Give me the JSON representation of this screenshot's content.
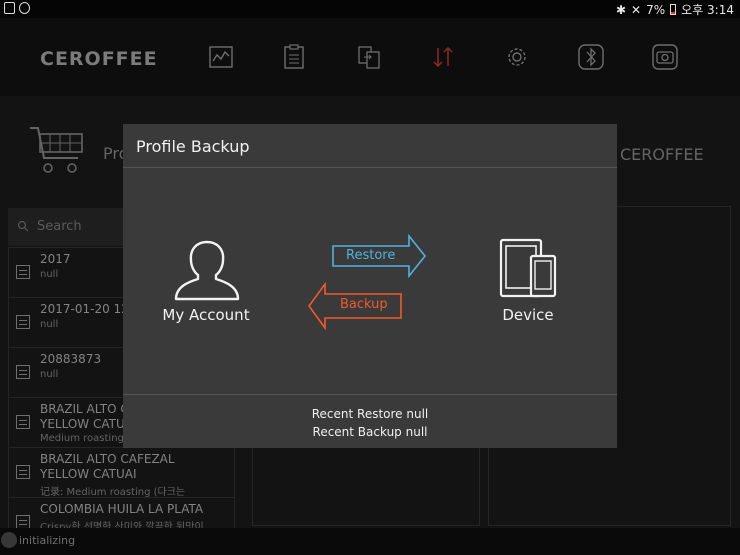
{
  "status_bar": {
    "battery": "7%",
    "time": "오후 3:14"
  },
  "header": {
    "logo": "CEROFFEE",
    "nav_icons": [
      "chart-icon",
      "clipboard-icon",
      "transfer-doc-icon",
      "sync-arrows-icon",
      "gear-icon",
      "bluetooth-icon",
      "camera-icon"
    ]
  },
  "background": {
    "page_title_partial": "Pro",
    "brand_right": "CEROFFEE",
    "search": {
      "placeholder": "Search"
    },
    "list": [
      {
        "title": "2017",
        "subtitle": "null"
      },
      {
        "title": "2017-01-20 12",
        "subtitle": "null"
      },
      {
        "title": "20883873",
        "subtitle": "null"
      },
      {
        "title": "BRAZIL ALTO C\nYELLOW CATU",
        "subtitle": "Medium roasting"
      },
      {
        "title": "BRAZIL ALTO CAFEZAL\nYELLOW CATUAI",
        "subtitle": "记录: Medium roasting (다크는"
      },
      {
        "title": "COLOMBIA HUILA LA PLATA",
        "subtitle": "Crispy한 선명한 산미와 깔끔한 뒷맛이"
      }
    ]
  },
  "bottom_bar": {
    "status": "initializing"
  },
  "modal": {
    "title": "Profile Backup",
    "account_label": "My Account",
    "device_label": "Device",
    "restore_label": "Restore",
    "backup_label": "Backup",
    "recent_restore": "Recent Restore null",
    "recent_backup": "Recent Backup null",
    "colors": {
      "restore": "#4fb3e0",
      "backup": "#f05a2a",
      "nav_active": "#d9442a"
    }
  }
}
